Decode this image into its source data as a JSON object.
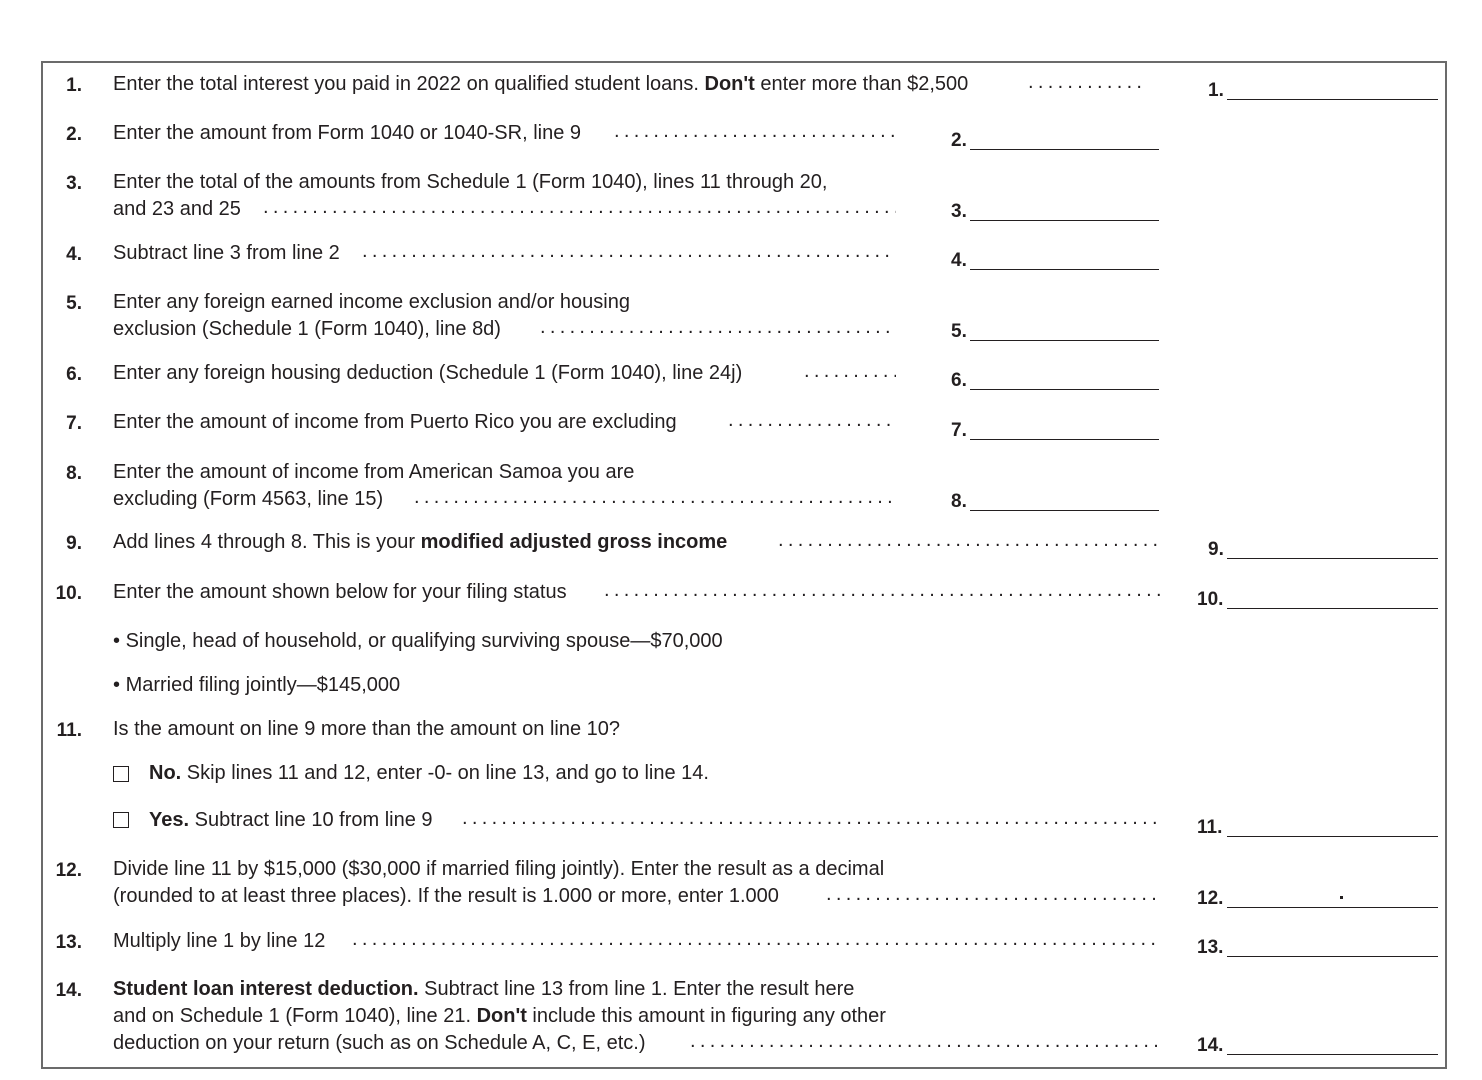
{
  "lines": [
    {
      "num": "1.",
      "text_a": "Enter the total interest you paid in 2022 on qualified student loans. ",
      "bold": "Don't",
      "text_b": " enter more than $2,500",
      "field": "1."
    },
    {
      "num": "2.",
      "text": "Enter the amount from Form 1040 or 1040-SR, line 9",
      "field": "2."
    },
    {
      "num": "3.",
      "text": "Enter the total of the amounts from Schedule 1 (Form 1040), lines 11 through 20,",
      "text2": "and 23 and 25",
      "field": "3."
    },
    {
      "num": "4.",
      "text": "Subtract line 3 from line 2",
      "field": "4."
    },
    {
      "num": "5.",
      "text": "Enter any foreign earned income exclusion and/or housing",
      "text2": "exclusion (Schedule 1 (Form 1040), line 8d)",
      "field": "5."
    },
    {
      "num": "6.",
      "text": "Enter any foreign housing deduction (Schedule 1 (Form 1040), line 24j)",
      "field": "6."
    },
    {
      "num": "7.",
      "text": "Enter the amount of income from Puerto Rico you are excluding",
      "field": "7."
    },
    {
      "num": "8.",
      "text": "Enter the amount of income from American Samoa you are",
      "text2": "excluding (Form 4563, line 15)",
      "field": "8."
    },
    {
      "num": "9.",
      "text_a": "Add lines 4 through 8. This is your ",
      "bold": "modified adjusted gross income",
      "field": "9."
    },
    {
      "num": "10.",
      "text": "Enter the amount shown below for your filing status",
      "field": "10.",
      "bullets": [
        "Single, head of household, or qualifying surviving spouse—$70,000",
        "Married filing jointly—$145,000"
      ]
    },
    {
      "num": "11.",
      "text": "Is the amount on line 9 more than the amount on line 10?",
      "field": "11.",
      "options": [
        {
          "bold": "No.",
          "text": " Skip lines 11 and 12, enter -0- on line 13, and go to line 14.",
          "checked": false
        },
        {
          "bold": "Yes.",
          "text": " Subtract line 10 from line 9",
          "checked": false
        }
      ]
    },
    {
      "num": "12.",
      "text": "Divide line 11 by $15,000 ($30,000 if married filing jointly). Enter the result as a decimal",
      "text2": "(rounded to at least three places). If the result is 1.000 or more, enter 1.000",
      "field": "12."
    },
    {
      "num": "13.",
      "text": "Multiply line 1 by line 12",
      "field": "13."
    },
    {
      "num": "14.",
      "bold": "Student loan interest deduction.",
      "text_b": " Subtract line 13 from line 1. Enter the result here",
      "text2_a": "and on Schedule 1 (Form 1040), line 21. ",
      "text2_bold": "Don't",
      "text2_b": " include this amount in figuring any other",
      "text3": "deduction on your return (such as on Schedule A, C, E, etc.)",
      "field": "14."
    }
  ]
}
